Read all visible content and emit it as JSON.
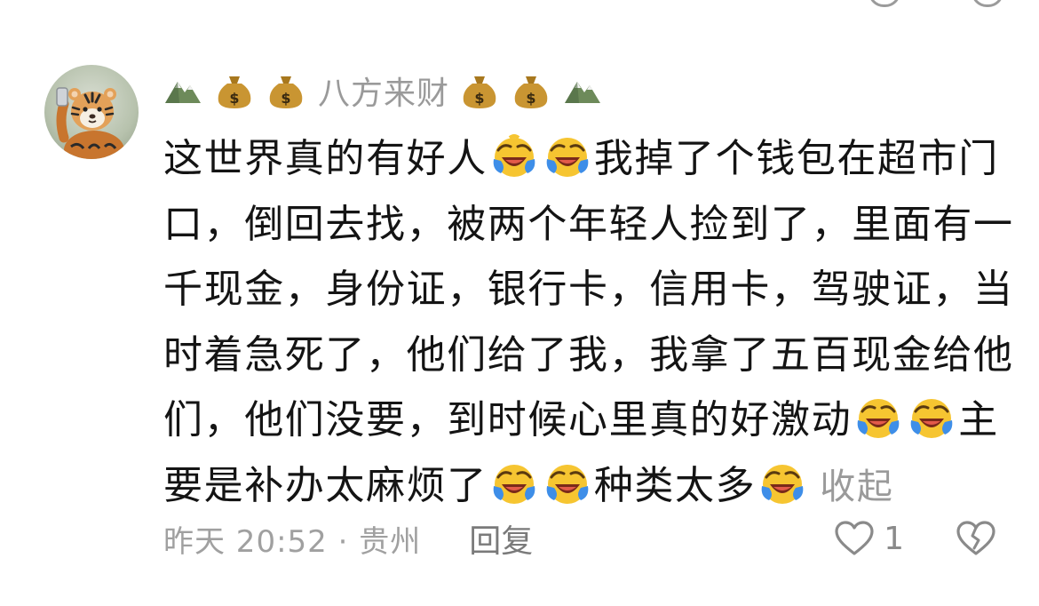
{
  "comment": {
    "nickname": {
      "text": "八方来财",
      "emoji_left": [
        "mountain-icon",
        "money-bag-icon",
        "money-bag-icon"
      ],
      "emoji_right": [
        "money-bag-icon",
        "money-bag-icon",
        "mountain-icon"
      ]
    },
    "content_lines": [
      {
        "segments": [
          "这世界真的有好人",
          "",
          "",
          "我掉了个钱包在超市门"
        ]
      },
      {
        "segments": [
          "口，倒回去找，被两个年轻人捡到了，里面有一"
        ]
      },
      {
        "segments": [
          "千现金，身份证，银行卡，信用卡，驾驶证，当"
        ]
      },
      {
        "segments": [
          "时着急死了，他们给了我，我拿了五百现金给他"
        ]
      },
      {
        "segments": [
          "们，他们没要，到时候心里真的好激动",
          "",
          "",
          "主"
        ]
      },
      {
        "segments": [
          "要是补办太麻烦了",
          "",
          "",
          "种类太多",
          ""
        ]
      }
    ],
    "line1_a": "这世界真的有好人",
    "line1_b": "我掉了个钱包在超市门",
    "line2": "口，倒回去找，被两个年轻人捡到了，里面有一",
    "line3": "千现金，身份证，银行卡，信用卡，驾驶证，当",
    "line4": "时着急死了，他们给了我，我拿了五百现金给他",
    "line5_a": "们，他们没要，到时候心里真的好激动",
    "line5_b": "主",
    "line6_a": "要是补办太麻烦了",
    "line6_b": "种类太多",
    "collapse_label": "收起",
    "emoji_name": "laughing-crying-emoji",
    "time_location": "昨天 20:52 · 贵州",
    "reply_label": "回复",
    "like_count": "1"
  },
  "colors": {
    "text_main": "#141414",
    "text_secondary": "#9a9a9a",
    "emoji_yellow": "#f6c531",
    "emoji_blue": "#3e8ee8"
  }
}
